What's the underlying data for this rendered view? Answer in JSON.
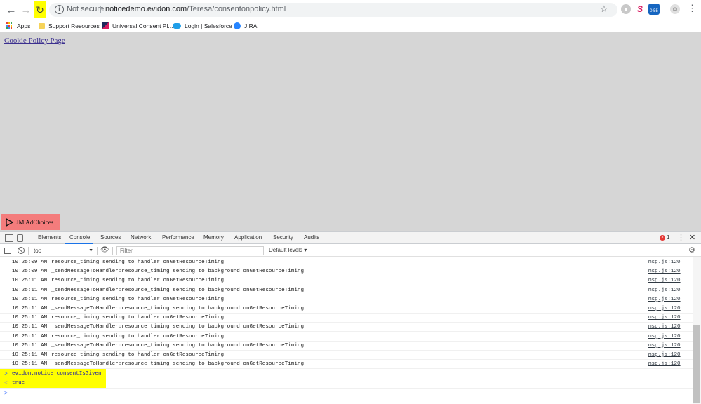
{
  "browser": {
    "back_icon": "arrow-left-icon",
    "forward_icon": "arrow-right-icon",
    "reload_icon": "reload-icon",
    "highlight_color": "#ffff00",
    "security_label": "Not secure",
    "url_host": "noticedemo.evidon.com",
    "url_path": "/Teresa/consentonpolicy.html"
  },
  "bookmarks": [
    {
      "label": "Apps",
      "icon": "apps-grid-icon"
    },
    {
      "label": "Support Resources",
      "icon": "folder-icon"
    },
    {
      "label": "Universal Consent Pl...",
      "icon": "ucp-icon"
    },
    {
      "label": "Login | Salesforce",
      "icon": "salesforce-icon"
    },
    {
      "label": "JIRA",
      "icon": "jira-icon"
    }
  ],
  "extensions": {
    "badge_text": "0.55"
  },
  "page": {
    "background": "#d6d6d6",
    "link_text": "Cookie Policy Page",
    "adchoices_label": "JM AdChoices",
    "adchoices_color": "#f47c7c"
  },
  "devtools": {
    "tabs": [
      "Elements",
      "Console",
      "Sources",
      "Network",
      "Performance",
      "Memory",
      "Application",
      "Security",
      "Audits"
    ],
    "active_tab": "Console",
    "error_count": "1",
    "context": "top",
    "filter_placeholder": "Filter",
    "levels_label": "Default levels",
    "logs": [
      {
        "time": "10:25:09 AM",
        "message": "resource_timing sending to handler onGetResourceTiming",
        "source": "msg.js:120"
      },
      {
        "time": "10:25:09 AM",
        "message": "_sendMessageToHandler:resource_timing sending to background onGetResourceTiming",
        "source": "msg.js:120"
      },
      {
        "time": "10:25:11 AM",
        "message": "resource_timing sending to handler onGetResourceTiming",
        "source": "msg.js:120"
      },
      {
        "time": "10:25:11 AM",
        "message": "_sendMessageToHandler:resource_timing sending to background onGetResourceTiming",
        "source": "msg.js:120"
      },
      {
        "time": "10:25:11 AM",
        "message": "resource_timing sending to handler onGetResourceTiming",
        "source": "msg.js:120"
      },
      {
        "time": "10:25:11 AM",
        "message": "_sendMessageToHandler:resource_timing sending to background onGetResourceTiming",
        "source": "msg.js:120"
      },
      {
        "time": "10:25:11 AM",
        "message": "resource_timing sending to handler onGetResourceTiming",
        "source": "msg.js:120"
      },
      {
        "time": "10:25:11 AM",
        "message": "_sendMessageToHandler:resource_timing sending to background onGetResourceTiming",
        "source": "msg.js:120"
      },
      {
        "time": "10:25:11 AM",
        "message": "resource_timing sending to handler onGetResourceTiming",
        "source": "msg.js:120"
      },
      {
        "time": "10:25:11 AM",
        "message": "_sendMessageToHandler:resource_timing sending to background onGetResourceTiming",
        "source": "msg.js:120"
      },
      {
        "time": "10:25:11 AM",
        "message": "resource_timing sending to handler onGetResourceTiming",
        "source": "msg.js:120"
      },
      {
        "time": "10:25:11 AM",
        "message": "_sendMessageToHandler:resource_timing sending to background onGetResourceTiming",
        "source": "msg.js:120"
      }
    ],
    "command": "evidon.notice.consentIsGiven",
    "result": "true",
    "prompt_symbol": ">",
    "result_symbol": "<"
  }
}
